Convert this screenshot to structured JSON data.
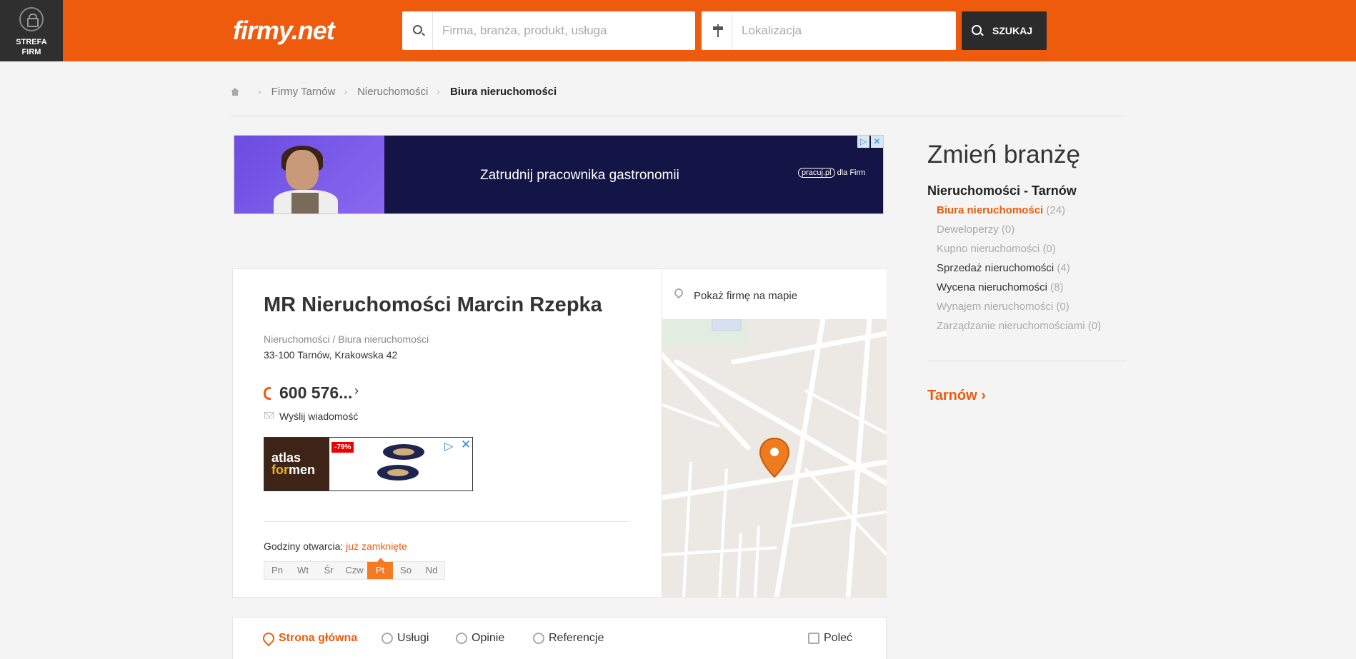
{
  "header": {
    "strefa_label": "STREFA\nFIRM",
    "logo": "firmy.net",
    "search_placeholder": "Firma, branża, produkt, usługa",
    "location_placeholder": "Lokalizacja",
    "search_button": "SZUKAJ"
  },
  "breadcrumb": [
    "Firmy Tarnów",
    "Nieruchomości",
    "Biura nieruchomości"
  ],
  "ad_top": {
    "text": "Zatrudnij pracownika gastronomii",
    "brand": "pracuj.pl",
    "brand_suffix": "dla Firm"
  },
  "company": {
    "name": "MR Nieruchomości Marcin Rzepka",
    "category": "Nieruchomości / Biura nieruchomości",
    "address": "33-100 Tarnów, Krakowska 42",
    "phone": "600 576...",
    "message_link": "Wyślij wiadomość",
    "hours_label": "Godziny otwarcia:",
    "hours_status": "już zamknięte",
    "days": [
      "Pn",
      "Wt",
      "Śr",
      "Czw",
      "Pt",
      "So",
      "Nd"
    ],
    "active_day": "Pt",
    "map_link": "Pokaż firmę na mapie"
  },
  "ad_small": {
    "brand_line1": "atlas",
    "brand_line2_a": "for",
    "brand_line2_b": "men",
    "discount": "-79%"
  },
  "tabs": {
    "home": "Strona główna",
    "services": "Usługi",
    "reviews": "Opinie",
    "references": "Referencje",
    "recommend": "Poleć"
  },
  "sidebar": {
    "title": "Zmień branżę",
    "group": "Nieruchomości - Tarnów",
    "items": [
      {
        "label": "Biura nieruchomości",
        "count": "(24)"
      },
      {
        "label": "Deweloperzy",
        "count": "(0)"
      },
      {
        "label": "Kupno nieruchomości",
        "count": "(0)"
      },
      {
        "label": "Sprzedaż nieruchomości",
        "count": "(4)"
      },
      {
        "label": "Wycena nieruchomości",
        "count": "(8)"
      },
      {
        "label": "Wynajem nieruchomości",
        "count": "(0)"
      },
      {
        "label": "Zarządzanie nieruchomościami",
        "count": "(0)"
      }
    ],
    "city": "Tarnów"
  },
  "colors": {
    "brand_orange": "#ef5b0c",
    "dark": "#2b2b2b"
  }
}
